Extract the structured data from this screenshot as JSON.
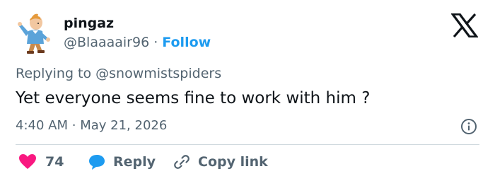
{
  "author": {
    "name": "pingaz",
    "handle": "@Blaaaair96",
    "separator": "·",
    "follow_label": "Follow",
    "avatar_icon": "tintin-avatar-icon"
  },
  "brand": {
    "logo_icon": "x-logo-icon",
    "color": "#0f1419"
  },
  "reply_context": {
    "prefix": "Replying to ",
    "target": "@snowmistspiders"
  },
  "tweet": {
    "text": "Yet everyone seems fine to work with him ?",
    "time": "4:40 AM",
    "separator": "·",
    "date": "May 21, 2026"
  },
  "actions": {
    "like_count": "74",
    "reply_label": "Reply",
    "copy_label": "Copy link"
  },
  "colors": {
    "accent": "#1d9bf0",
    "like": "#f91880",
    "secondary_text": "#536471"
  }
}
